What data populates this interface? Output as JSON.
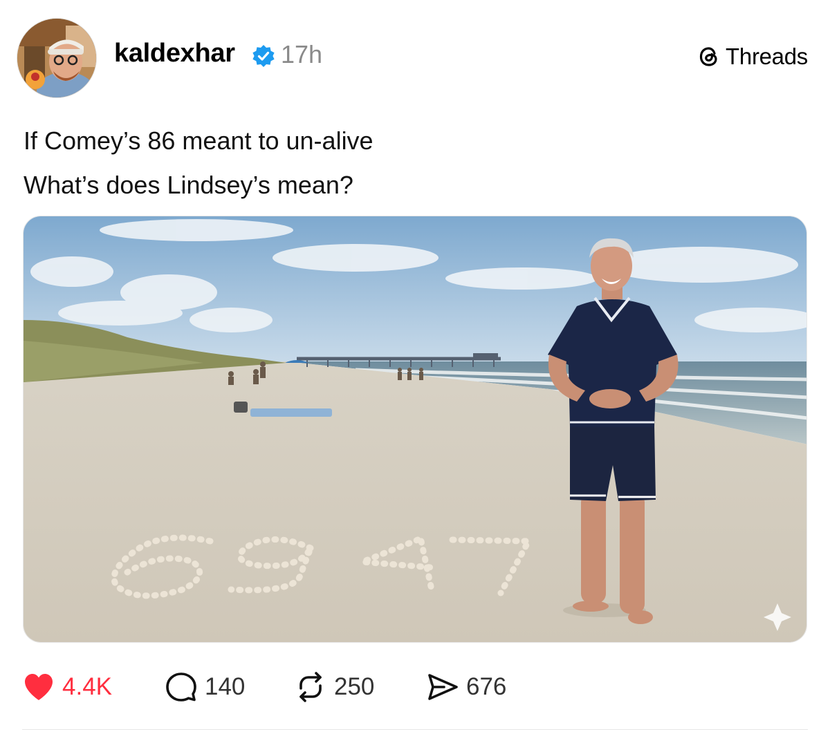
{
  "post": {
    "username": "kaldexhar",
    "verified": true,
    "timestamp": "17h",
    "brand_label": "Threads",
    "caption_lines": [
      "If Comey’s 86 meant to un-alive",
      "What’s does Lindsey’s mean?"
    ],
    "actions": {
      "likes": "4.4K",
      "replies": "140",
      "reposts": "250",
      "shares": "676"
    }
  },
  "icons": {
    "avatar": "profile-photo",
    "verified": "verified-badge-icon",
    "brand": "threads-logo-icon",
    "like": "heart-icon",
    "reply": "speech-bubble-icon",
    "repost": "repost-icon",
    "share": "send-icon"
  },
  "colors": {
    "like_red": "#ff2e3f",
    "verified_blue": "#1d9bf0",
    "muted_gray": "#8a8a8a"
  }
}
